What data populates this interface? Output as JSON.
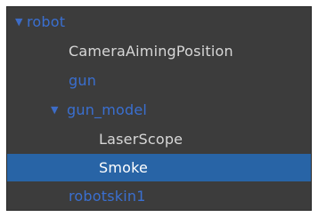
{
  "hierarchy": {
    "items": [
      {
        "label": "robot",
        "expanded": true,
        "type": "prefab"
      },
      {
        "label": "CameraAimingPosition",
        "type": "normal"
      },
      {
        "label": "gun",
        "type": "prefab"
      },
      {
        "label": "gun_model",
        "expanded": true,
        "type": "prefab"
      },
      {
        "label": "LaserScope",
        "type": "normal"
      },
      {
        "label": "Smoke",
        "type": "normal",
        "selected": true
      },
      {
        "label": "robotskin1",
        "type": "prefab"
      }
    ]
  },
  "icons": {
    "expand": "triangle-down-icon"
  },
  "colors": {
    "panel_background": "#3c3c3c",
    "prefab_text": "#3a6fd0",
    "normal_text": "#d7d7d7",
    "selection_background": "#2864a6",
    "selected_text": "#ffffff"
  }
}
